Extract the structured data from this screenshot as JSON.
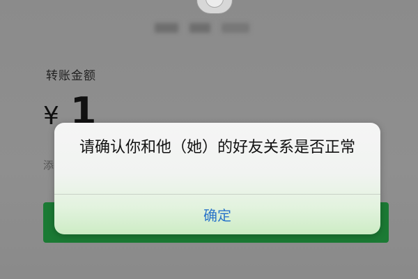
{
  "transfer": {
    "label": "转账金额",
    "currency_symbol": "¥",
    "amount": "1",
    "hint_partial": "添"
  },
  "dialog": {
    "message": "请确认你和他（她）的好友关系是否正常",
    "confirm_label": "确定"
  },
  "colors": {
    "accent_green": "#1b7a34",
    "confirm_blue": "#2a74c9",
    "overlay_gray": "#8e8e8e"
  }
}
